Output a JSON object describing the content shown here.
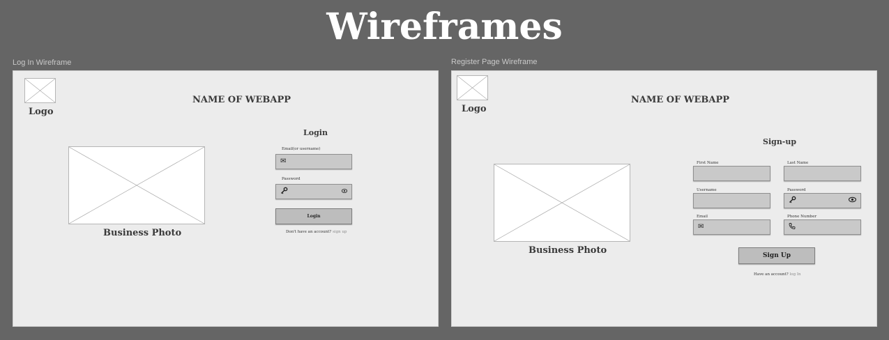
{
  "page_title": "Wireframes",
  "login": {
    "frame_label": "Log In Wireframe",
    "logo_label": "Logo",
    "app_name": "NAME OF WEBAPP",
    "photo_label": "Business Photo",
    "form_title": "Login",
    "email_label": "Email(or username)",
    "password_label": "Password",
    "button_label": "Login",
    "no_account_text": "Don't have an account?",
    "signup_link": "sign up"
  },
  "register": {
    "frame_label": "Register Page Wireframe",
    "logo_label": "Logo",
    "app_name": "NAME OF WEBAPP",
    "photo_label": "Business Photo",
    "form_title": "Sign-up",
    "first_name_label": "First Name",
    "last_name_label": "Last Name",
    "username_label": "Username",
    "password_label": "Password",
    "email_label": "Email",
    "phone_label": "Phone Number",
    "button_label": "Sign Up",
    "have_account_text": "Have an account?",
    "login_link": "log In"
  },
  "icons": {
    "envelope": "envelope-icon",
    "key": "key-icon",
    "eye": "eye-icon",
    "phone": "phone-icon"
  }
}
